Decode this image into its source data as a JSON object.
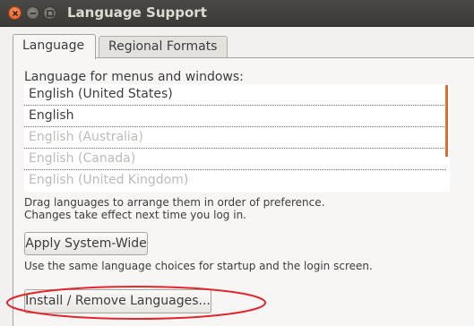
{
  "window": {
    "title": "Language Support",
    "controls": [
      "close",
      "minimize",
      "maximize"
    ]
  },
  "tabs": [
    {
      "label": "Language",
      "active": true
    },
    {
      "label": "Regional Formats",
      "active": false
    }
  ],
  "language_tab": {
    "list_heading": "Language for menus and windows:",
    "languages": [
      {
        "label": "English (United States)",
        "enabled": true
      },
      {
        "label": "English",
        "enabled": true
      },
      {
        "label": "English (Australia)",
        "enabled": false
      },
      {
        "label": "English (Canada)",
        "enabled": false
      },
      {
        "label": "English (United Kingdom)",
        "enabled": false
      }
    ],
    "drag_hint_line1": "Drag languages to arrange them in order of preference.",
    "drag_hint_line2": "Changes take effect next time you log in.",
    "apply_button": "Apply System-Wide",
    "apply_hint": "Use the same language choices for startup and the login screen.",
    "install_button": "Install / Remove Languages..."
  },
  "colors": {
    "accent": "#d96f32",
    "annotation": "#e0262e",
    "close_button": "#e0571c"
  }
}
